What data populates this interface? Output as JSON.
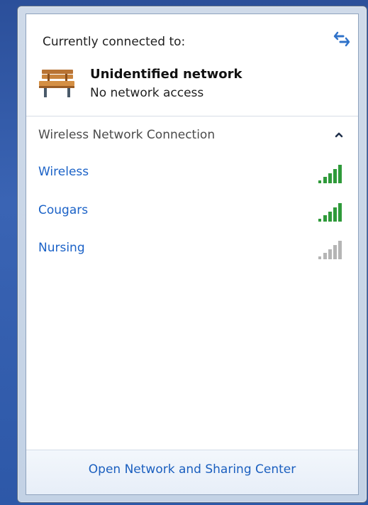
{
  "header": {
    "connected_label": "Currently connected to:",
    "network_name": "Unidentified network",
    "network_status": "No network access"
  },
  "section": {
    "title": "Wireless Network Connection"
  },
  "networks": [
    {
      "name": "Wireless",
      "signal_bars": 5,
      "signal_color": "green"
    },
    {
      "name": "Cougars",
      "signal_bars": 5,
      "signal_color": "green"
    },
    {
      "name": "Nursing",
      "signal_bars": 5,
      "signal_color": "gray"
    }
  ],
  "footer": {
    "link_label": "Open Network and Sharing Center"
  },
  "colors": {
    "link_blue": "#1b62c7",
    "signal_green": "#2f9a3a",
    "signal_gray": "#b5b5b5"
  },
  "icons": {
    "refresh": "refresh-icon",
    "network": "bench-icon",
    "collapse": "chevron-up-icon",
    "signal": "signal-strength-icon"
  }
}
